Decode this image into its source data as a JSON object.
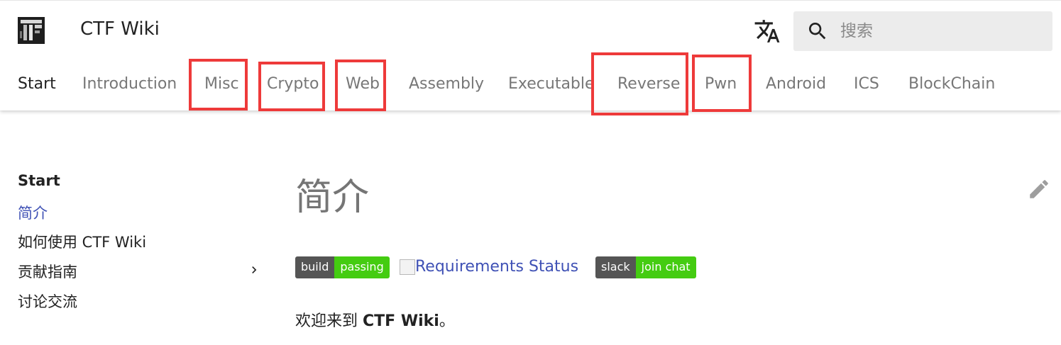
{
  "header": {
    "site_title": "CTF Wiki",
    "search_placeholder": "搜索"
  },
  "tabs": [
    {
      "label": "Start",
      "active": true,
      "highlighted": false
    },
    {
      "label": "Introduction",
      "active": false,
      "highlighted": false
    },
    {
      "label": "Misc",
      "active": false,
      "highlighted": true
    },
    {
      "label": "Crypto",
      "active": false,
      "highlighted": true
    },
    {
      "label": "Web",
      "active": false,
      "highlighted": true
    },
    {
      "label": "Assembly",
      "active": false,
      "highlighted": false
    },
    {
      "label": "Executable",
      "active": false,
      "highlighted": false
    },
    {
      "label": "Reverse",
      "active": false,
      "highlighted": true
    },
    {
      "label": "Pwn",
      "active": false,
      "highlighted": true
    },
    {
      "label": "Android",
      "active": false,
      "highlighted": false
    },
    {
      "label": "ICS",
      "active": false,
      "highlighted": false
    },
    {
      "label": "BlockChain",
      "active": false,
      "highlighted": false
    }
  ],
  "sidebar": {
    "heading": "Start",
    "items": [
      {
        "label": "简介",
        "active": true
      },
      {
        "label": "如何使用 CTF Wiki",
        "active": false
      },
      {
        "label": "贡献指南",
        "active": false,
        "expandable": true
      },
      {
        "label": "讨论交流",
        "active": false
      }
    ]
  },
  "content": {
    "title": "简介",
    "badges": {
      "build_left": "build",
      "build_right": "passing",
      "requirements_alt": "Requirements Status",
      "slack_left": "slack",
      "slack_right": "join chat"
    },
    "welcome_prefix": "欢迎来到 ",
    "welcome_bold": "CTF Wiki",
    "welcome_suffix": "。"
  },
  "colors": {
    "accent": "#3f51b5",
    "highlight_box": "#ee3a3a",
    "badge_green": "#44cc11",
    "badge_gray": "#555555"
  }
}
